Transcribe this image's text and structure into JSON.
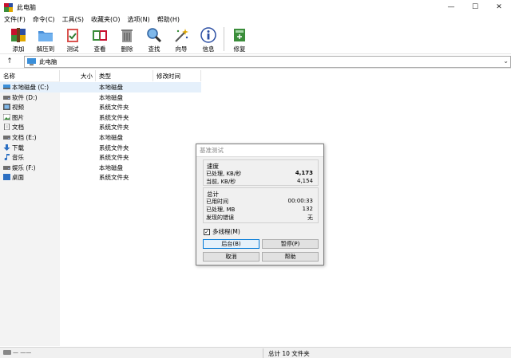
{
  "window": {
    "title": "此电脑"
  },
  "window_controls": {
    "minimize": "—",
    "maximize": "☐",
    "close": "✕"
  },
  "menu": [
    "文件(F)",
    "命令(C)",
    "工具(S)",
    "收藏夹(O)",
    "选项(N)",
    "帮助(H)"
  ],
  "toolbar": [
    {
      "label": "添加",
      "icon": "archive-add-icon"
    },
    {
      "label": "解压到",
      "icon": "extract-folder-icon"
    },
    {
      "label": "测试",
      "icon": "test-clipboard-icon"
    },
    {
      "label": "查看",
      "icon": "view-book-icon"
    },
    {
      "label": "删除",
      "icon": "trash-icon"
    },
    {
      "label": "查找",
      "icon": "magnifier-icon"
    },
    {
      "label": "向导",
      "icon": "wizard-wand-icon"
    },
    {
      "label": "信息",
      "icon": "info-icon"
    },
    {
      "label": "修复",
      "icon": "repair-book-icon"
    }
  ],
  "address": {
    "up": "↑",
    "path": "此电脑",
    "dropdown": "⌄"
  },
  "columns": {
    "name": "名称",
    "size": "大小",
    "type": "类型",
    "modified": "修改时间"
  },
  "files": [
    {
      "name": "本地磁盘 (C:)",
      "type": "本地磁盘",
      "icon": "drive-icon",
      "selected": true
    },
    {
      "name": "软件 (D:)",
      "type": "本地磁盘",
      "icon": "drive-icon"
    },
    {
      "name": "视频",
      "type": "系统文件夹",
      "icon": "video-icon"
    },
    {
      "name": "图片",
      "type": "系统文件夹",
      "icon": "picture-icon"
    },
    {
      "name": "文档",
      "type": "系统文件夹",
      "icon": "document-icon"
    },
    {
      "name": "文档 (E:)",
      "type": "本地磁盘",
      "icon": "drive-icon"
    },
    {
      "name": "下载",
      "type": "系统文件夹",
      "icon": "download-icon"
    },
    {
      "name": "音乐",
      "type": "系统文件夹",
      "icon": "music-icon"
    },
    {
      "name": "娱乐 (F:)",
      "type": "本地磁盘",
      "icon": "drive-icon"
    },
    {
      "name": "桌面",
      "type": "系统文件夹",
      "icon": "desktop-icon"
    }
  ],
  "dialog": {
    "title": "基准测试",
    "speed": {
      "title": "速度",
      "processed_label": "已处理, KB/秒",
      "processed_value": "4,173",
      "current_label": "当前, KB/秒",
      "current_value": "4,154"
    },
    "total": {
      "title": "总计",
      "elapsed_label": "已用时间",
      "elapsed_value": "00:00:33",
      "processed_label": "已处理, MB",
      "processed_value": "132",
      "errors_label": "发现的错误",
      "errors_value": "无"
    },
    "multithread": {
      "label": "多线程(M)",
      "checked": true,
      "mark": "✓"
    },
    "buttons": {
      "background": "后台(B)",
      "pause": "暂停(P)",
      "cancel": "取消",
      "help": "帮助"
    }
  },
  "status": {
    "summary": "总计 10 文件夹",
    "left": "— ——"
  },
  "colors": {
    "accent": "#0078d7",
    "selection": "#e5f0fb"
  }
}
